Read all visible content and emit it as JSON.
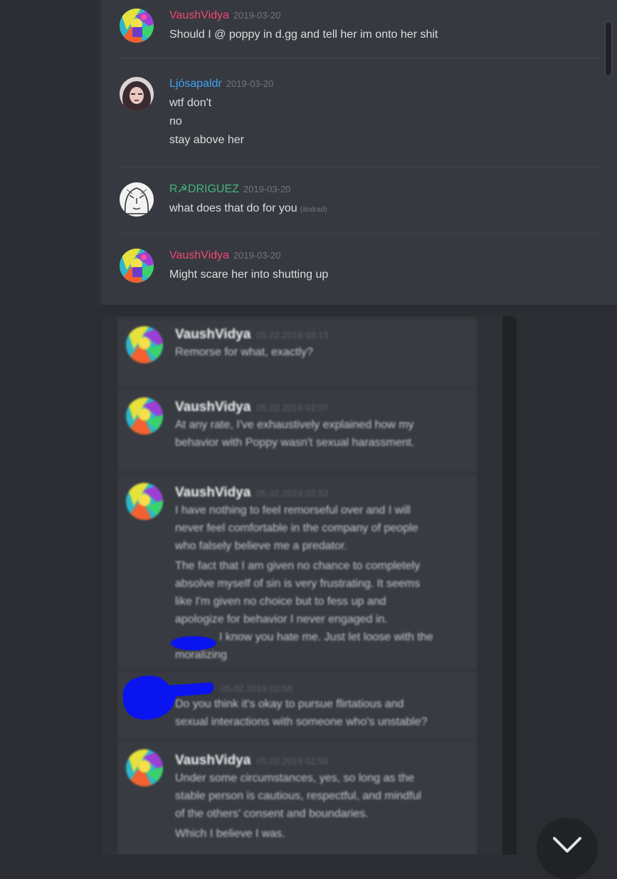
{
  "top_messages": [
    {
      "author": "VaushVidya",
      "author_color": "#f04770",
      "date": "2019-03-20",
      "lines": [
        "Should I @ poppy in d.gg and tell her im onto her shit"
      ],
      "edited": "",
      "avatar": "colorful-abstract-avatar"
    },
    {
      "author": "Ljósapaldr",
      "author_color": "#3ba3ef",
      "date": "2019-03-20",
      "lines": [
        "wtf don't",
        "no",
        "stay above her"
      ],
      "edited": "",
      "avatar": "portrait-avatar"
    },
    {
      "author": "R☭DRIGUEZ",
      "author_color": "#43b581",
      "date": "2019-03-20",
      "lines": [
        "what does that do for you"
      ],
      "edited": "(ändrad)",
      "avatar": "sketch-face-avatar"
    },
    {
      "author": "VaushVidya",
      "author_color": "#f04770",
      "date": "2019-03-20",
      "lines": [
        "Might scare her into shutting up"
      ],
      "edited": "",
      "avatar": "colorful-abstract-avatar"
    }
  ],
  "blurred_messages": [
    {
      "author": "VaushVidya",
      "date": "05.02.2019 03:13",
      "lines": [
        "Remorse for what, exactly?"
      ]
    },
    {
      "author": "VaushVidya",
      "date": "05.02.2019 03:07",
      "lines": [
        "At any rate, I've exhaustively explained how my",
        "behavior with Poppy wasn't sexual harassment."
      ]
    },
    {
      "author": "VaushVidya",
      "date": "05.02.2019 02:52",
      "lines": [
        "I have nothing to feel remorseful over and I will",
        "never feel comfortable in the company of people",
        "who falsely believe me a predator.",
        "The fact that I am given no chance to completely",
        "absolve myself of sin is very frustrating. It seems",
        "like I'm given no choice but to fess up and",
        "apologize for behavior I never engaged in.",
        "I know you hate me. Just let loose with the",
        "moralizing"
      ]
    },
    {
      "author": "",
      "date": "05.02.2019 02:56",
      "lines": [
        "Do you think it's okay to pursue flirtatious and",
        "sexual interactions with someone who's unstable?"
      ]
    },
    {
      "author": "VaushVidya",
      "date": "05.02.2019 02:56",
      "lines": [
        "Under some circumstances, yes, so long as the",
        "stable person is cautious, respectful, and mindful",
        "of the others' consent and boundaries.",
        "Which I believe I was."
      ]
    }
  ],
  "colors": {
    "redaction": "#0a14f0",
    "background": "#36393f",
    "text": "#dcddde",
    "timestamp": "#72767d"
  },
  "jump_button": {
    "icon": "chevron-down-icon"
  }
}
